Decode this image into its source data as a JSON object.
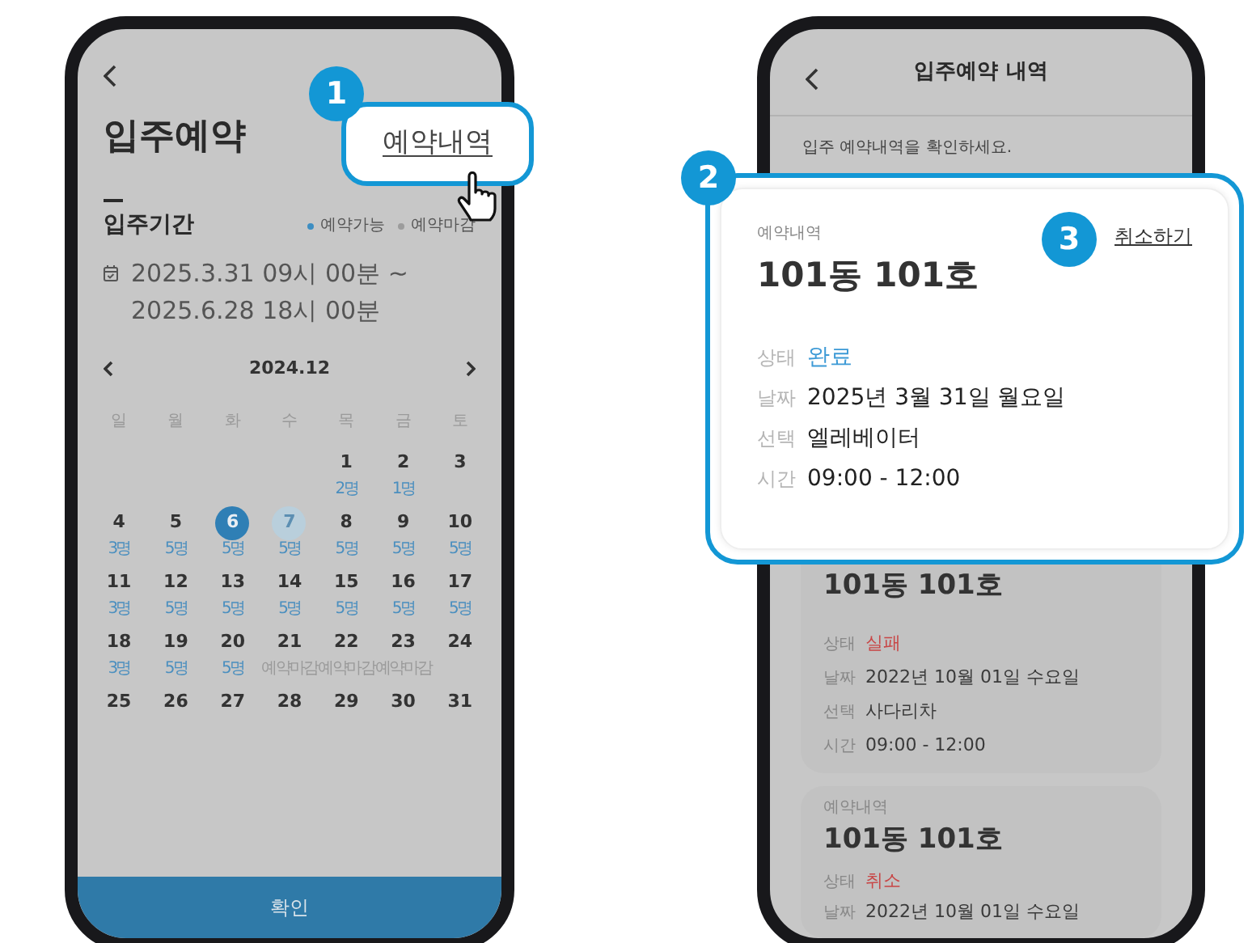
{
  "left_screen": {
    "title": "입주예약",
    "history_link": {
      "label": "예약내역",
      "step": "1"
    },
    "period": {
      "label": "입주기간",
      "legend": [
        {
          "label": "예약가능",
          "color": "#3d8ec2"
        },
        {
          "label": "예약마감",
          "color": "#9c9c9c"
        }
      ],
      "lines": [
        "2025.3.31 09시 00분 ~",
        "2025.6.28 18시 00분"
      ]
    },
    "calendar": {
      "month": "2024.12",
      "weekdays": [
        "일",
        "월",
        "화",
        "수",
        "목",
        "금",
        "토"
      ],
      "weeks": [
        [
          {
            "kind": "empty"
          },
          {
            "kind": "empty"
          },
          {
            "kind": "empty"
          },
          {
            "kind": "empty"
          },
          {
            "kind": "day",
            "day": "1",
            "note": {
              "text": "2명",
              "color": "#4b8fbf"
            },
            "selected": false,
            "in_range": false
          },
          {
            "kind": "day",
            "day": "2",
            "note": {
              "text": "1명",
              "color": "#4b8fbf"
            },
            "selected": false,
            "in_range": false
          },
          {
            "kind": "day",
            "day": "3",
            "selected": false,
            "in_range": false
          }
        ],
        [
          {
            "day": "4",
            "note": {
              "text": "3명",
              "color": "#4b8fbf"
            },
            "selected": false,
            "in_range": false
          },
          {
            "day": "5",
            "note": {
              "text": "5명",
              "color": "#4b8fbf"
            },
            "selected": false,
            "in_range": false
          },
          {
            "day": "6",
            "note": {
              "text": "5명",
              "color": "#4b8fbf"
            },
            "selected": true,
            "in_range": false
          },
          {
            "day": "7",
            "note": {
              "text": "5명",
              "color": "#4b8fbf"
            },
            "selected": false,
            "in_range": true
          },
          {
            "day": "8",
            "note": {
              "text": "5명",
              "color": "#4b8fbf"
            },
            "selected": false,
            "in_range": false
          },
          {
            "day": "9",
            "note": {
              "text": "5명",
              "color": "#4b8fbf"
            },
            "selected": false,
            "in_range": false
          },
          {
            "day": "10",
            "note": {
              "text": "5명",
              "color": "#4b8fbf"
            },
            "selected": false,
            "in_range": false
          }
        ],
        [
          {
            "day": "11",
            "note": {
              "text": "3명",
              "color": "#4b8fbf"
            },
            "selected": false,
            "in_range": false
          },
          {
            "day": "12",
            "note": {
              "text": "5명",
              "color": "#4b8fbf"
            },
            "selected": false,
            "in_range": false
          },
          {
            "day": "13",
            "note": {
              "text": "5명",
              "color": "#4b8fbf"
            },
            "selected": false,
            "in_range": false
          },
          {
            "day": "14",
            "note": {
              "text": "5명",
              "color": "#4b8fbf"
            },
            "selected": false,
            "in_range": false
          },
          {
            "day": "15",
            "note": {
              "text": "5명",
              "color": "#4b8fbf"
            },
            "selected": false,
            "in_range": false
          },
          {
            "day": "16",
            "note": {
              "text": "5명",
              "color": "#4b8fbf"
            },
            "selected": false,
            "in_range": false
          },
          {
            "day": "17",
            "note": {
              "text": "5명",
              "color": "#4b8fbf"
            },
            "selected": false,
            "in_range": false
          }
        ],
        [
          {
            "day": "18",
            "note": {
              "text": "3명",
              "color": "#4b8fbf"
            },
            "selected": false,
            "in_range": false
          },
          {
            "day": "19",
            "note": {
              "text": "5명",
              "color": "#4b8fbf"
            },
            "selected": false,
            "in_range": false
          },
          {
            "day": "20",
            "note": {
              "text": "5명",
              "color": "#4b8fbf"
            },
            "selected": false,
            "in_range": false
          },
          {
            "day": "21",
            "note": {
              "text": "예약마감",
              "color": "#9a9a9a"
            },
            "selected": false,
            "in_range": false
          },
          {
            "day": "22",
            "note": {
              "text": "예약마감",
              "color": "#9a9a9a"
            },
            "selected": false,
            "in_range": false
          },
          {
            "day": "23",
            "note": {
              "text": "예약마감",
              "color": "#9a9a9a"
            },
            "selected": false,
            "in_range": false
          },
          {
            "day": "24",
            "selected": false,
            "in_range": false
          }
        ],
        [
          {
            "day": "25",
            "selected": false,
            "in_range": false
          },
          {
            "day": "26",
            "selected": false,
            "in_range": false
          },
          {
            "day": "27",
            "selected": false,
            "in_range": false
          },
          {
            "day": "28",
            "selected": false,
            "in_range": false
          },
          {
            "day": "29",
            "selected": false,
            "in_range": false
          },
          {
            "day": "30",
            "selected": false,
            "in_range": false
          },
          {
            "day": "31",
            "selected": false,
            "in_range": false
          }
        ]
      ]
    },
    "confirm_button": "확인"
  },
  "right_screen": {
    "title": "입주예약 내역",
    "subtitle": "입주 예약내역을 확인하세요.",
    "cards": [
      {
        "highlighted": true,
        "step": "2",
        "label": "예약내역",
        "unit": "101동 101호",
        "cancel": {
          "label": "취소하기",
          "step": "3"
        },
        "rows": [
          {
            "key": "상태",
            "value": "완료",
            "kind": "status",
            "color": "#3d9ad6"
          },
          {
            "key": "날짜",
            "value": "2025년 3월 31일 월요일",
            "kind": "text"
          },
          {
            "key": "선택",
            "value": "엘레베이터",
            "kind": "text"
          },
          {
            "key": "시간",
            "value": "09:00 - 12:00",
            "kind": "text"
          }
        ]
      },
      {
        "highlighted": false,
        "unit": "101동 101호",
        "rows": [
          {
            "key": "상태",
            "value": "실패",
            "kind": "status",
            "color": "#c84646"
          },
          {
            "key": "날짜",
            "value": "2022년 10월 01일 수요일",
            "kind": "text"
          },
          {
            "key": "선택",
            "value": "사다리차",
            "kind": "text"
          },
          {
            "key": "시간",
            "value": "09:00 - 12:00",
            "kind": "text"
          }
        ]
      },
      {
        "highlighted": false,
        "label": "예약내역",
        "unit": "101동 101호",
        "rows": [
          {
            "key": "상태",
            "value": "취소",
            "kind": "status",
            "color": "#c84646"
          },
          {
            "key": "날짜",
            "value": "2022년 10월 01일 수요일",
            "kind": "text"
          }
        ]
      }
    ]
  }
}
